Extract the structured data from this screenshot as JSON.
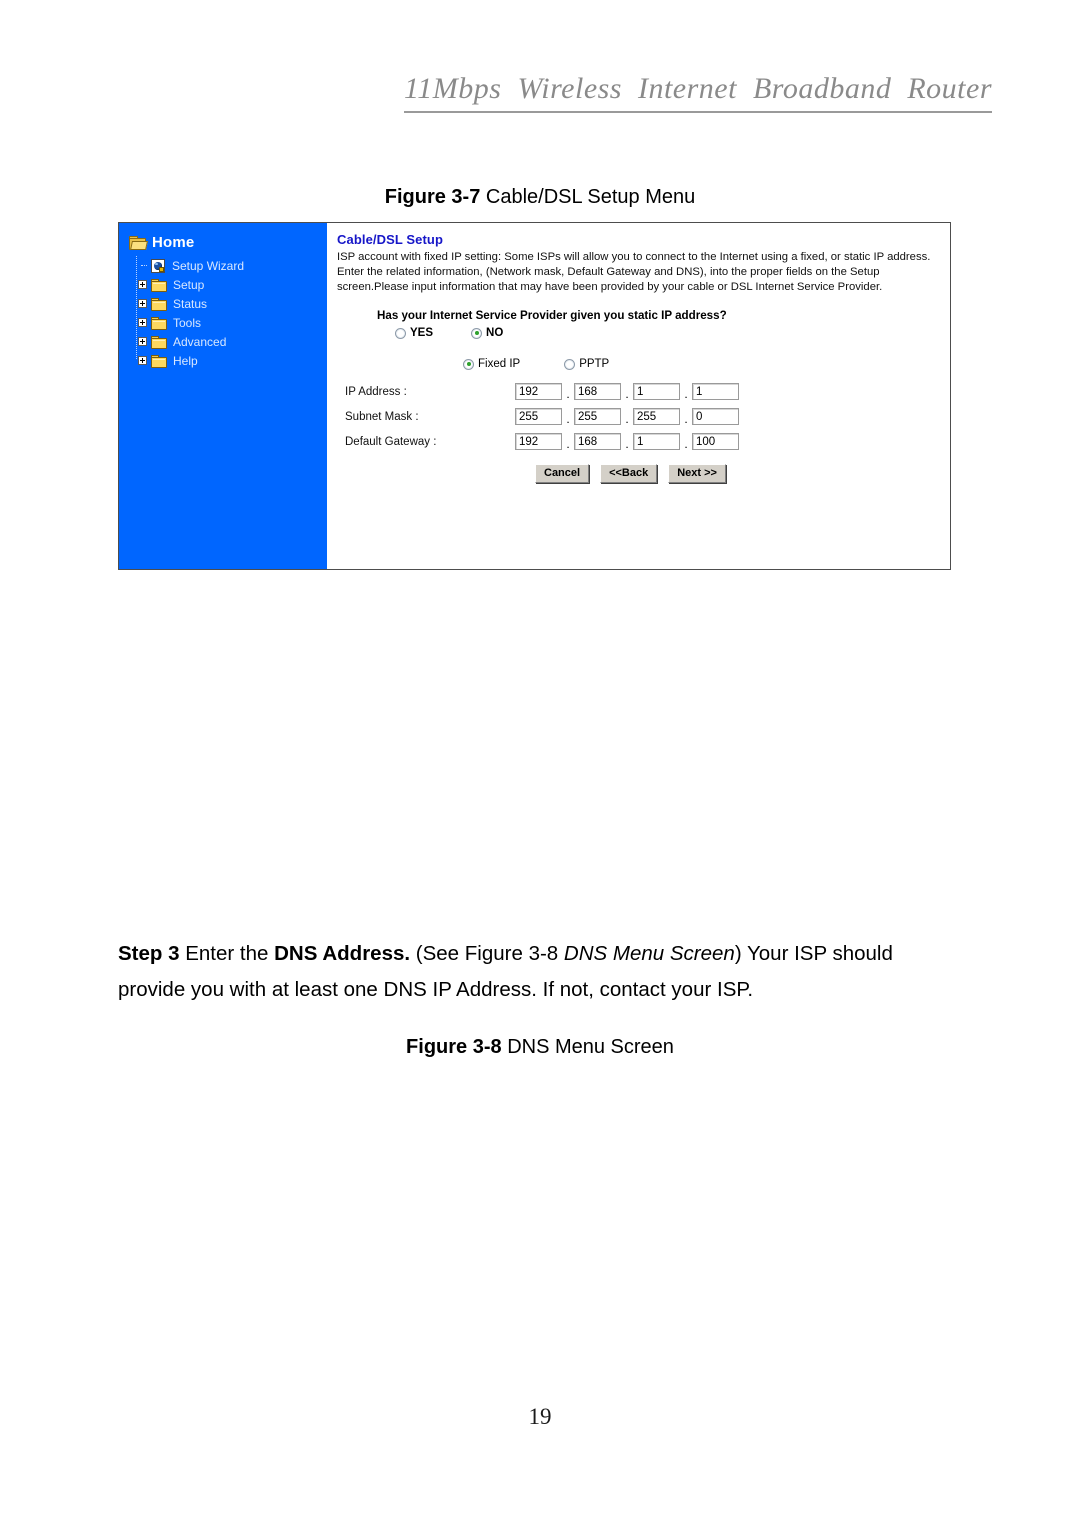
{
  "header": {
    "running_title": "11Mbps  Wireless  Internet  Broadband  Router"
  },
  "figure_7": {
    "caption_label": "Figure 3-7",
    "caption_title": "Cable/DSL Setup Menu"
  },
  "figure_8": {
    "caption_label": "Figure 3-8",
    "caption_title": "DNS Menu Screen"
  },
  "router_ui": {
    "sidebar": {
      "home_label": "Home",
      "home_icon": "open-folder-icon",
      "items": [
        {
          "label": "Setup Wizard",
          "icon": "setup-wizard-globe-icon",
          "expandable": false
        },
        {
          "label": "Setup",
          "icon": "folder-icon",
          "expandable": true
        },
        {
          "label": "Status",
          "icon": "folder-icon",
          "expandable": true
        },
        {
          "label": "Tools",
          "icon": "folder-icon",
          "expandable": true
        },
        {
          "label": "Advanced",
          "icon": "folder-icon",
          "expandable": true
        },
        {
          "label": "Help",
          "icon": "folder-icon",
          "expandable": true
        }
      ]
    },
    "content": {
      "title": "Cable/DSL Setup",
      "description": "ISP account with fixed IP setting: Some ISPs will allow you to connect to the Internet using a fixed, or static IP address. Enter the related information, (Network mask, Default Gateway and DNS), into the proper fields on the Setup screen.Please input information that may have been provided by your cable or DSL Internet Service Provider.",
      "question": "Has your Internet Service Provider given you static IP address?",
      "static_ip_options": [
        {
          "label": "YES",
          "selected": false
        },
        {
          "label": "NO",
          "selected": true
        }
      ],
      "connection_type_options": [
        {
          "label": "Fixed IP",
          "selected": true
        },
        {
          "label": "PPTP",
          "selected": false
        }
      ],
      "fields": [
        {
          "label": "IP Address :",
          "octets": [
            "192",
            "168",
            "1",
            "1"
          ]
        },
        {
          "label": "Subnet Mask :",
          "octets": [
            "255",
            "255",
            "255",
            "0"
          ]
        },
        {
          "label": "Default Gateway :",
          "octets": [
            "192",
            "168",
            "1",
            "100"
          ]
        }
      ],
      "buttons": [
        {
          "label": "Cancel"
        },
        {
          "label": "<<Back"
        },
        {
          "label": "Next >>"
        }
      ]
    }
  },
  "step_paragraph": {
    "step_label": "Step 3",
    "text_1": " Enter the ",
    "bold_2": "DNS Address.",
    "text_3": " (See Figure 3-8 ",
    "italic_4": "DNS Menu Screen",
    "text_5": ") Your ISP should provide you with at least one DNS IP Address. If not, contact your ISP."
  },
  "page": {
    "number": "19"
  },
  "colors": {
    "sidebar_blue": "#0066ff",
    "panel_title_blue": "#1616c8",
    "header_gray": "#8a8a8a",
    "radio_selected_green": "#2ea12e",
    "button_face": "#d4d0c8"
  }
}
